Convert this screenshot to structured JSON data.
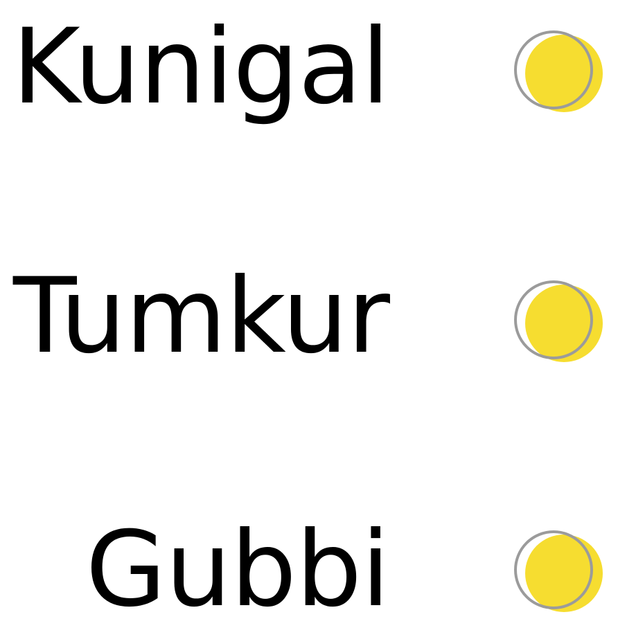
{
  "stops": [
    {
      "label": "Kunigal"
    },
    {
      "label": "Tumkur"
    },
    {
      "label": "Gubbi"
    }
  ],
  "colors": {
    "marker_fill": "#F6DD30",
    "marker_ring": "#9B9B9B",
    "text": "#000000",
    "background": "#FFFFFF"
  }
}
